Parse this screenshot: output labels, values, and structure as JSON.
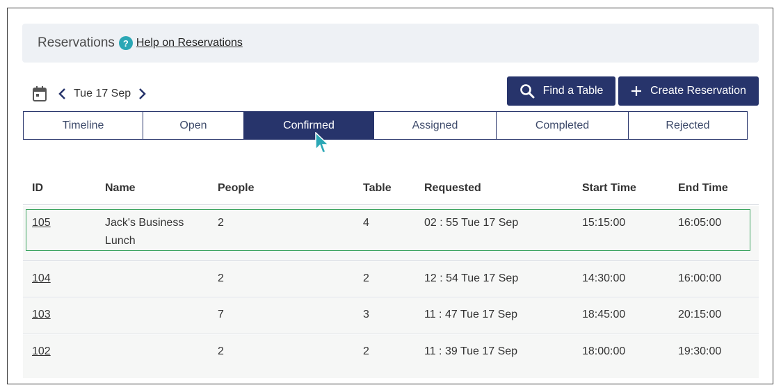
{
  "header": {
    "title": "Reservations",
    "help_icon_glyph": "?",
    "help_link": "Help on Reservations"
  },
  "date_nav": {
    "label": "Tue 17 Sep",
    "icons": [
      "calendar-icon",
      "chevron-left-icon",
      "chevron-right-icon"
    ]
  },
  "actions": {
    "find_table": "Find a Table",
    "create_reservation": "Create Reservation",
    "icons": [
      "search-icon",
      "plus-icon"
    ]
  },
  "tabs": [
    {
      "label": "Timeline",
      "active": false
    },
    {
      "label": "Open",
      "active": false
    },
    {
      "label": "Confirmed",
      "active": true
    },
    {
      "label": "Assigned",
      "active": false
    },
    {
      "label": "Completed",
      "active": false
    },
    {
      "label": "Rejected",
      "active": false
    }
  ],
  "table": {
    "columns": [
      "ID",
      "Name",
      "People",
      "Table",
      "Requested",
      "Start Time",
      "End Time"
    ],
    "rows": [
      {
        "id": "105",
        "name_line1": "Jack's Business",
        "name_line2": "Lunch",
        "people": "2",
        "table": "4",
        "requested": "02 : 55 Tue 17 Sep",
        "start": "15:15:00",
        "end": "16:05:00",
        "highlighted": true
      },
      {
        "id": "104",
        "name_line1": "",
        "name_line2": "",
        "people": "2",
        "table": "2",
        "requested": "12 : 54 Tue 17 Sep",
        "start": "14:30:00",
        "end": "16:00:00",
        "highlighted": false
      },
      {
        "id": "103",
        "name_line1": "",
        "name_line2": "",
        "people": "7",
        "table": "3",
        "requested": "11 : 47 Tue 17 Sep",
        "start": "18:45:00",
        "end": "20:15:00",
        "highlighted": false
      },
      {
        "id": "102",
        "name_line1": "",
        "name_line2": "",
        "people": "2",
        "table": "2",
        "requested": "11 : 39 Tue 17 Sep",
        "start": "18:00:00",
        "end": "19:30:00",
        "highlighted": false
      }
    ]
  },
  "colors": {
    "primary": "#27346b",
    "help_teal": "#2ba7b5",
    "highlight_outline": "#3aa35e",
    "cursor": "#2ba7b5"
  }
}
